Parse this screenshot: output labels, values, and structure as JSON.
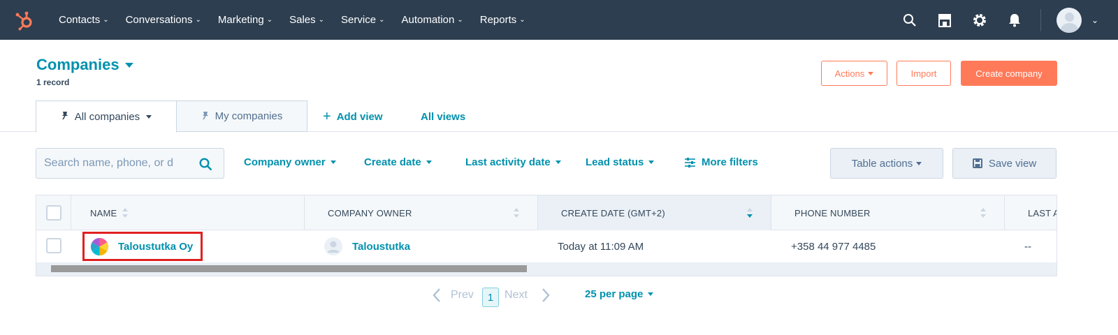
{
  "nav": {
    "items": [
      {
        "label": "Contacts"
      },
      {
        "label": "Conversations"
      },
      {
        "label": "Marketing"
      },
      {
        "label": "Sales"
      },
      {
        "label": "Service"
      },
      {
        "label": "Automation"
      },
      {
        "label": "Reports"
      }
    ],
    "icons": [
      "search-icon",
      "marketplace-icon",
      "settings-icon",
      "notifications-icon",
      "avatar"
    ]
  },
  "header": {
    "title": "Companies",
    "record_count": "1 record",
    "actions_label": "Actions",
    "import_label": "Import",
    "create_label": "Create company"
  },
  "tabs": {
    "all": "All companies",
    "my": "My companies",
    "add_view": "Add view",
    "all_views": "All views"
  },
  "filters": {
    "search_placeholder": "Search name, phone, or d",
    "company_owner": "Company owner",
    "create_date": "Create date",
    "last_activity": "Last activity date",
    "lead_status": "Lead status",
    "more_filters": "More filters",
    "table_actions": "Table actions",
    "save_view": "Save view"
  },
  "table": {
    "columns": [
      "NAME",
      "COMPANY OWNER",
      "CREATE DATE (GMT+2)",
      "PHONE NUMBER",
      "LAST A"
    ],
    "rows": [
      {
        "name": "Taloustutka Oy",
        "owner": "Taloustutka",
        "create_date": "Today at 11:09 AM",
        "phone": "+358 44 977 4485",
        "last_activity": "--"
      }
    ]
  },
  "pagination": {
    "prev": "Prev",
    "page": "1",
    "next": "Next",
    "per_page": "25 per page"
  },
  "colors": {
    "nav_bg": "#2d3e50",
    "accent": "#0091ae",
    "orange": "#ff7a59",
    "highlight": "#e02020"
  }
}
